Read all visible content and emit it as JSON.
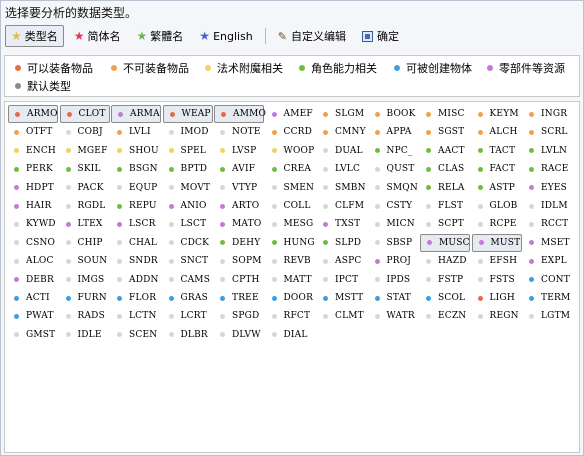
{
  "window": {
    "title": "选择要分析的数据类型。"
  },
  "toolbar": {
    "items": [
      {
        "label": "类型名",
        "icon": "star-icon",
        "color": "#e8b84a",
        "active": true
      },
      {
        "label": "简体名",
        "icon": "star-icon",
        "color": "#e5384f",
        "active": false
      },
      {
        "label": "繁體名",
        "icon": "star-icon",
        "color": "#5fbf4a",
        "active": false
      },
      {
        "label": "English",
        "icon": "star-icon",
        "color": "#4b62c8",
        "active": false
      }
    ],
    "custom_edit_label": "自定义编辑",
    "confirm_label": "确定"
  },
  "legend": [
    {
      "label": "可以装备物品",
      "color": "#e86a4a"
    },
    {
      "label": "不可装备物品",
      "color": "#f0a050"
    },
    {
      "label": "法术附魔相关",
      "color": "#f2d260"
    },
    {
      "label": "角色能力相关",
      "color": "#6cbf3e"
    },
    {
      "label": "可被创建物体",
      "color": "#3f9de0"
    },
    {
      "label": "零部件等资源",
      "color": "#c47ad6"
    },
    {
      "label": "默认类型",
      "color": "#8a8a8a"
    }
  ],
  "colors": {
    "r": "#e86a4a",
    "o": "#f0a050",
    "y": "#f2d260",
    "g": "#6cbf3e",
    "b": "#3f9de0",
    "p": "#c47ad6",
    "w": "#d6d6d6"
  },
  "grid": [
    [
      [
        "ARMO",
        "r",
        true
      ],
      [
        "CLOT",
        "r",
        true
      ],
      [
        "ARMA",
        "p",
        true
      ],
      [
        "WEAP",
        "r",
        true
      ],
      [
        "AMMO",
        "r",
        true
      ],
      [
        "AMEF",
        "p"
      ],
      [
        "SLGM",
        "o"
      ],
      [
        "BOOK",
        "o"
      ],
      [
        "MISC",
        "o"
      ],
      [
        "KEYM",
        "o"
      ],
      [
        "INGR",
        "o"
      ]
    ],
    [
      [
        "OTFT",
        "o"
      ],
      [
        "COBJ",
        "w"
      ],
      [
        "LVLI",
        "o"
      ],
      [
        "IMOD",
        "w"
      ],
      [
        "NOTE",
        "w"
      ],
      [
        "CCRD",
        "o"
      ],
      [
        "CMNY",
        "o"
      ],
      [
        "APPA",
        "o"
      ],
      [
        "SGST",
        "o"
      ],
      [
        "ALCH",
        "o"
      ],
      [
        "SCRL",
        "o"
      ]
    ],
    [
      [
        "ENCH",
        "y"
      ],
      [
        "MGEF",
        "y"
      ],
      [
        "SHOU",
        "y"
      ],
      [
        "SPEL",
        "y"
      ],
      [
        "LVSP",
        "y"
      ],
      [
        "WOOP",
        "y"
      ],
      [
        "DUAL",
        "w"
      ],
      [
        "NPC_",
        "g"
      ],
      [
        "AACT",
        "g"
      ],
      [
        "TACT",
        "g"
      ],
      [
        "LVLN",
        "g"
      ]
    ],
    [
      [
        "PERK",
        "g"
      ],
      [
        "SKIL",
        "g"
      ],
      [
        "BSGN",
        "g"
      ],
      [
        "BPTD",
        "g"
      ],
      [
        "AVIF",
        "g"
      ],
      [
        "CREA",
        "g"
      ],
      [
        "LVLC",
        "w"
      ],
      [
        "QUST",
        "w"
      ],
      [
        "CLAS",
        "g"
      ],
      [
        "FACT",
        "g"
      ],
      [
        "RACE",
        "g"
      ]
    ],
    [
      [
        "HDPT",
        "p"
      ],
      [
        "PACK",
        "w"
      ],
      [
        "EQUP",
        "w"
      ],
      [
        "MOVT",
        "w"
      ],
      [
        "VTYP",
        "w"
      ],
      [
        "SMEN",
        "w"
      ],
      [
        "SMBN",
        "w"
      ],
      [
        "SMQN",
        "w"
      ],
      [
        "RELA",
        "g"
      ],
      [
        "ASTP",
        "g"
      ],
      [
        "EYES",
        "p"
      ]
    ],
    [
      [
        "HAIR",
        "p"
      ],
      [
        "RGDL",
        "w"
      ],
      [
        "REPU",
        "g"
      ],
      [
        "ANIO",
        "p"
      ],
      [
        "ARTO",
        "p"
      ],
      [
        "COLL",
        "w"
      ],
      [
        "CLFM",
        "w"
      ],
      [
        "CSTY",
        "w"
      ],
      [
        "FLST",
        "w"
      ],
      [
        "GLOB",
        "w"
      ],
      [
        "IDLM",
        "w"
      ]
    ],
    [
      [
        "KYWD",
        "w"
      ],
      [
        "LTEX",
        "p"
      ],
      [
        "LSCR",
        "p"
      ],
      [
        "LSCT",
        "w"
      ],
      [
        "MATO",
        "p"
      ],
      [
        "MESG",
        "w"
      ],
      [
        "TXST",
        "p"
      ],
      [
        "MICN",
        "w"
      ],
      [
        "SCPT",
        "w"
      ],
      [
        "RCPE",
        "w"
      ],
      [
        "RCCT",
        "w"
      ]
    ],
    [
      [
        "CSNO",
        "w"
      ],
      [
        "CHIP",
        "w"
      ],
      [
        "CHAL",
        "w"
      ],
      [
        "CDCK",
        "w"
      ],
      [
        "DEHY",
        "g"
      ],
      [
        "HUNG",
        "g"
      ],
      [
        "SLPD",
        "g"
      ],
      [
        "SBSP",
        "w"
      ],
      [
        "MUSC",
        "p",
        true
      ],
      [
        "MUST",
        "p",
        true
      ],
      [
        "MSET",
        "p"
      ]
    ],
    [
      [
        "ALOC",
        "w"
      ],
      [
        "SOUN",
        "w"
      ],
      [
        "SNDR",
        "w"
      ],
      [
        "SNCT",
        "w"
      ],
      [
        "SOPM",
        "w"
      ],
      [
        "REVB",
        "w"
      ],
      [
        "ASPC",
        "w"
      ],
      [
        "PROJ",
        "p"
      ],
      [
        "HAZD",
        "w"
      ],
      [
        "EFSH",
        "w"
      ],
      [
        "EXPL",
        "p"
      ]
    ],
    [
      [
        "DEBR",
        "p"
      ],
      [
        "IMGS",
        "w"
      ],
      [
        "ADDN",
        "w"
      ],
      [
        "CAMS",
        "w"
      ],
      [
        "CPTH",
        "w"
      ],
      [
        "MATT",
        "w"
      ],
      [
        "IPCT",
        "w"
      ],
      [
        "IPDS",
        "w"
      ],
      [
        "FSTP",
        "w"
      ],
      [
        "FSTS",
        "w"
      ],
      [
        "CONT",
        "b"
      ]
    ],
    [
      [
        "ACTI",
        "b"
      ],
      [
        "FURN",
        "b"
      ],
      [
        "FLOR",
        "b"
      ],
      [
        "GRAS",
        "b"
      ],
      [
        "TREE",
        "b"
      ],
      [
        "DOOR",
        "b"
      ],
      [
        "MSTT",
        "b"
      ],
      [
        "STAT",
        "b"
      ],
      [
        "SCOL",
        "b"
      ],
      [
        "LIGH",
        "r"
      ],
      [
        "TERM",
        "b"
      ]
    ],
    [
      [
        "PWAT",
        "b"
      ],
      [
        "RADS",
        "w"
      ],
      [
        "LCTN",
        "w"
      ],
      [
        "LCRT",
        "w"
      ],
      [
        "SPGD",
        "w"
      ],
      [
        "RFCT",
        "w"
      ],
      [
        "CLMT",
        "w"
      ],
      [
        "WATR",
        "w"
      ],
      [
        "ECZN",
        "w"
      ],
      [
        "REGN",
        "w"
      ],
      [
        "LGTM",
        "w"
      ]
    ],
    [
      [
        "GMST",
        "w"
      ],
      [
        "IDLE",
        "w"
      ],
      [
        "SCEN",
        "w"
      ],
      [
        "DLBR",
        "w"
      ],
      [
        "DLVW",
        "w"
      ],
      [
        "DIAL",
        "w"
      ]
    ]
  ]
}
